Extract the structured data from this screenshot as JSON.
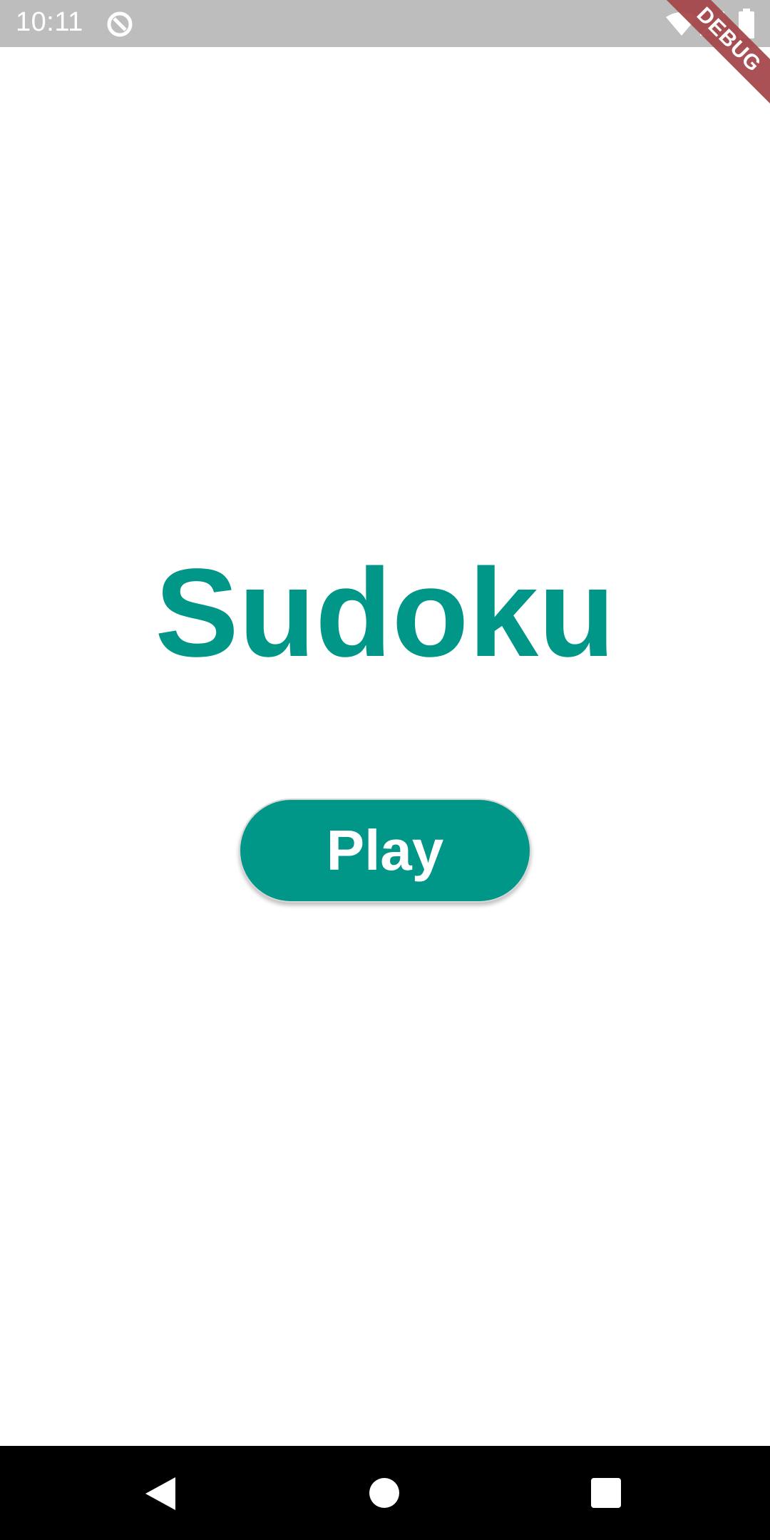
{
  "status_bar": {
    "time": "10:11",
    "icons": [
      "sync-icon",
      "wifi-icon",
      "signal-icon",
      "battery-icon"
    ]
  },
  "debug_banner": {
    "label": "DEBUG"
  },
  "main": {
    "title": "Sudoku",
    "play_label": "Play"
  },
  "nav_bar": {
    "icons": [
      "back-icon",
      "home-icon",
      "recents-icon"
    ]
  },
  "colors": {
    "accent": "#009688",
    "status_bar_bg": "#bdbdbd",
    "nav_bar_bg": "#000000",
    "debug_ribbon": "#a5484c"
  }
}
